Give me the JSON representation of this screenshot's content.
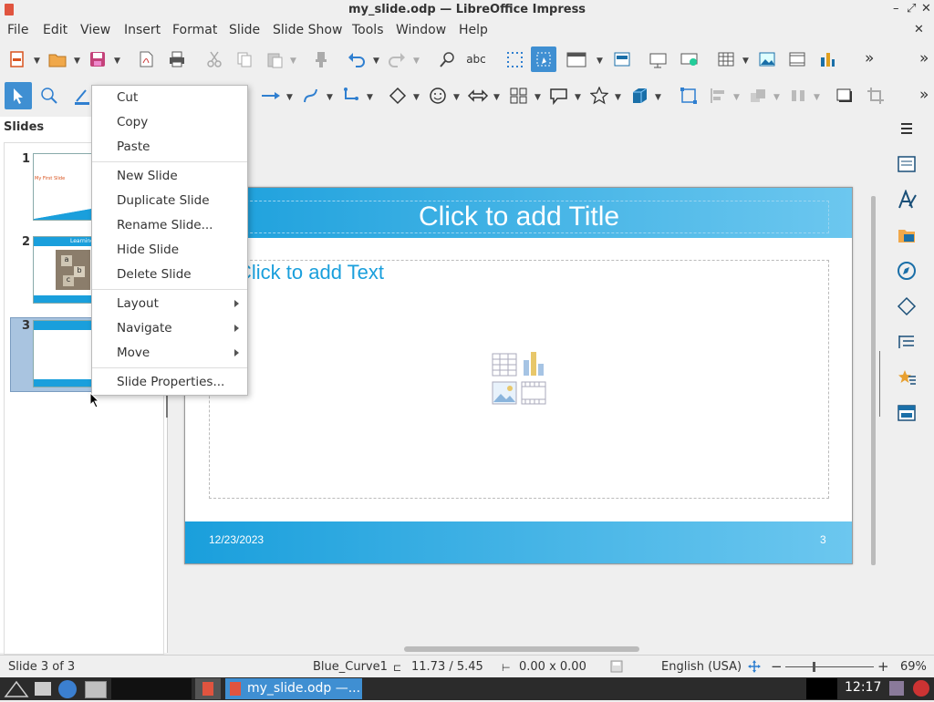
{
  "window": {
    "title": "my_slide.odp — LibreOffice Impress",
    "minimize": "–",
    "restore": "⤢",
    "close": "✕",
    "doc_close": "✕"
  },
  "menubar": {
    "items": [
      "File",
      "Edit",
      "View",
      "Insert",
      "Format",
      "Slide",
      "Slide Show",
      "Tools",
      "Window",
      "Help"
    ]
  },
  "slides_panel": {
    "title": "Slides",
    "thumbnails": [
      {
        "number": "1",
        "text": "My First Slide"
      },
      {
        "number": "2",
        "text": "Learning"
      },
      {
        "number": "3",
        "text": ""
      }
    ],
    "thumb2_blocks": [
      "a",
      "b",
      "c"
    ]
  },
  "slide": {
    "title_placeholder": "Click to add Title",
    "text_placeholder": "Click to add Text",
    "footer_date": "12/23/2023",
    "footer_page": "3"
  },
  "context_menu": {
    "items": [
      {
        "label": "Cut"
      },
      {
        "label": "Copy"
      },
      {
        "label": "Paste"
      },
      {
        "label": "New Slide"
      },
      {
        "label": "Duplicate Slide"
      },
      {
        "label": "Rename Slide..."
      },
      {
        "label": "Hide Slide"
      },
      {
        "label": "Delete Slide"
      },
      {
        "label": "Layout",
        "submenu": true
      },
      {
        "label": "Navigate",
        "submenu": true
      },
      {
        "label": "Move",
        "submenu": true
      },
      {
        "label": "Slide Properties..."
      }
    ]
  },
  "statusbar": {
    "slide_pos": "Slide 3 of 3",
    "master": "Blue_Curve1",
    "position": "11.73 / 5.45",
    "size": "0.00 x 0.00",
    "language": "English (USA)",
    "zoom": "69%",
    "zoom_minus": "−",
    "zoom_plus": "+"
  },
  "taskbar": {
    "task_label": "my_slide.odp —...",
    "clock": "12:17"
  },
  "toolbar": {
    "overflow_1": "»",
    "overflow_2": "»",
    "spell_glyph": "abc"
  },
  "colors": {
    "accent": "#1a9fdc",
    "brand": "#e0543f",
    "selected": "#3f8fd2"
  },
  "icons": [
    "new-icon",
    "open-icon",
    "save-icon",
    "export-pdf-icon",
    "print-icon",
    "cut-icon",
    "copy-icon",
    "paste-icon",
    "clone-icon",
    "undo-icon",
    "redo-icon",
    "find-replace-icon",
    "spelling-icon",
    "grid-icon",
    "helplines-icon",
    "display-views-icon",
    "master-slide-icon",
    "start-first-icon",
    "start-current-icon",
    "table-icon",
    "image-icon",
    "media-icon",
    "chart-icon",
    "select-icon",
    "zoom-icon",
    "line-color-icon",
    "arrow-line-icon",
    "curve-icon",
    "connector-icon",
    "basic-shapes-icon",
    "symbol-shapes-icon",
    "block-arrows-icon",
    "flowchart-icon",
    "callout-icon",
    "stars-icon",
    "3d-objects-icon",
    "rotate-icon",
    "align-icon",
    "arrange-icon",
    "distribute-icon",
    "shadow-icon",
    "crop-icon",
    "sidebar-menu-icon",
    "properties-icon",
    "styles-icon",
    "gallery-icon",
    "navigator-icon",
    "shapes-icon",
    "slide-transition-icon",
    "animation-icon",
    "master-slides-icon"
  ]
}
